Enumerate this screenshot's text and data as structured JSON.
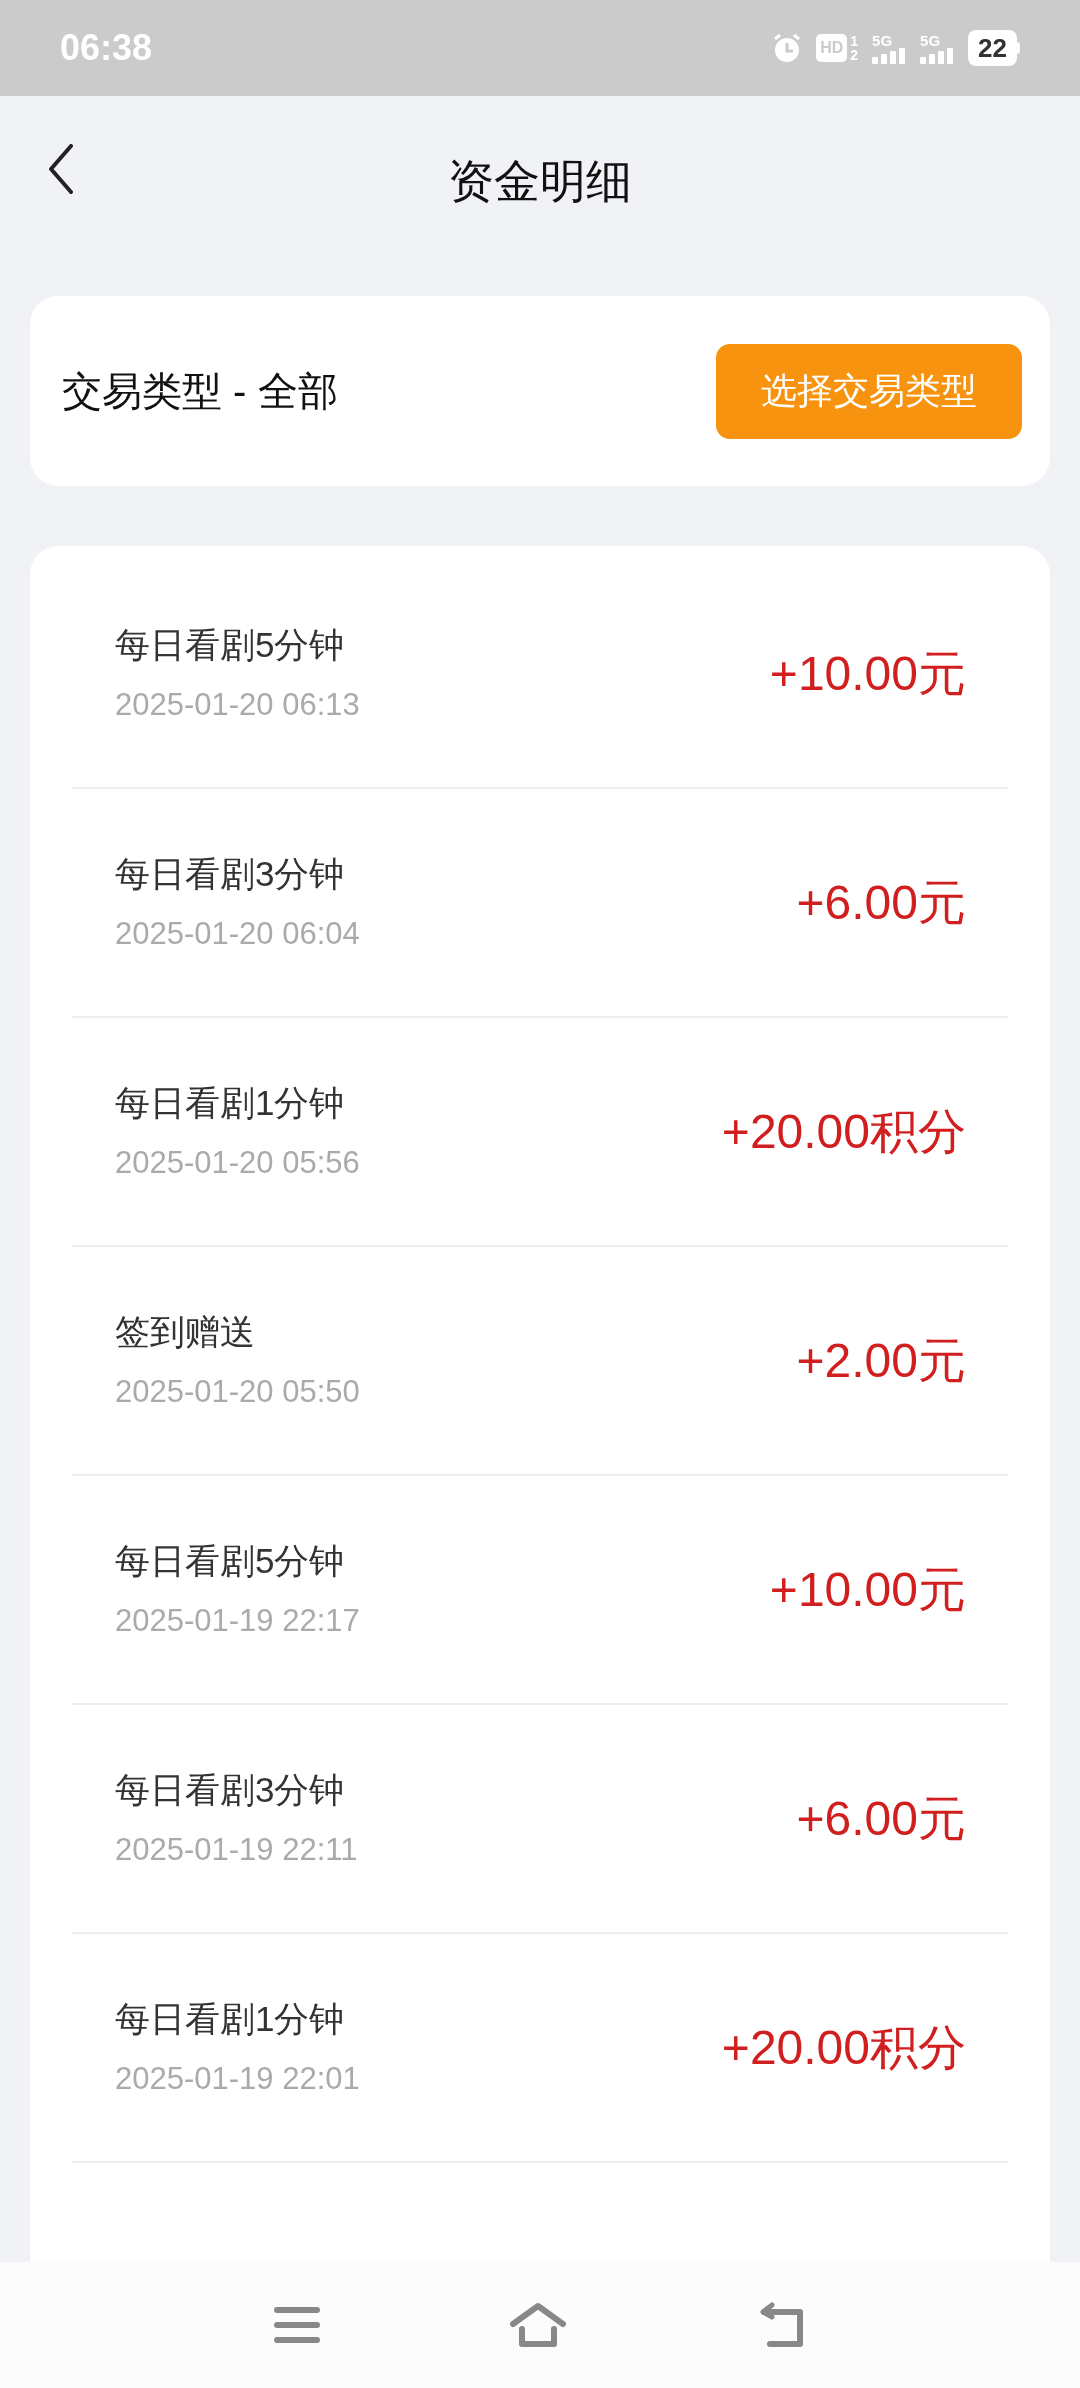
{
  "status_bar": {
    "time": "06:38",
    "hd": "HD",
    "sim": "1",
    "sim2": "2",
    "network_1": "5G",
    "network_2": "5G",
    "battery": "22"
  },
  "header": {
    "title": "资金明细"
  },
  "filter": {
    "label": "交易类型 - 全部",
    "button": "选择交易类型"
  },
  "transactions": [
    {
      "title": "每日看剧5分钟",
      "time": "2025-01-20 06:13",
      "amount": "+10.00元"
    },
    {
      "title": "每日看剧3分钟",
      "time": "2025-01-20 06:04",
      "amount": "+6.00元"
    },
    {
      "title": "每日看剧1分钟",
      "time": "2025-01-20 05:56",
      "amount": "+20.00积分"
    },
    {
      "title": "签到赠送",
      "time": "2025-01-20 05:50",
      "amount": "+2.00元"
    },
    {
      "title": "每日看剧5分钟",
      "time": "2025-01-19 22:17",
      "amount": "+10.00元"
    },
    {
      "title": "每日看剧3分钟",
      "time": "2025-01-19 22:11",
      "amount": "+6.00元"
    },
    {
      "title": "每日看剧1分钟",
      "time": "2025-01-19 22:01",
      "amount": "+20.00积分"
    }
  ]
}
